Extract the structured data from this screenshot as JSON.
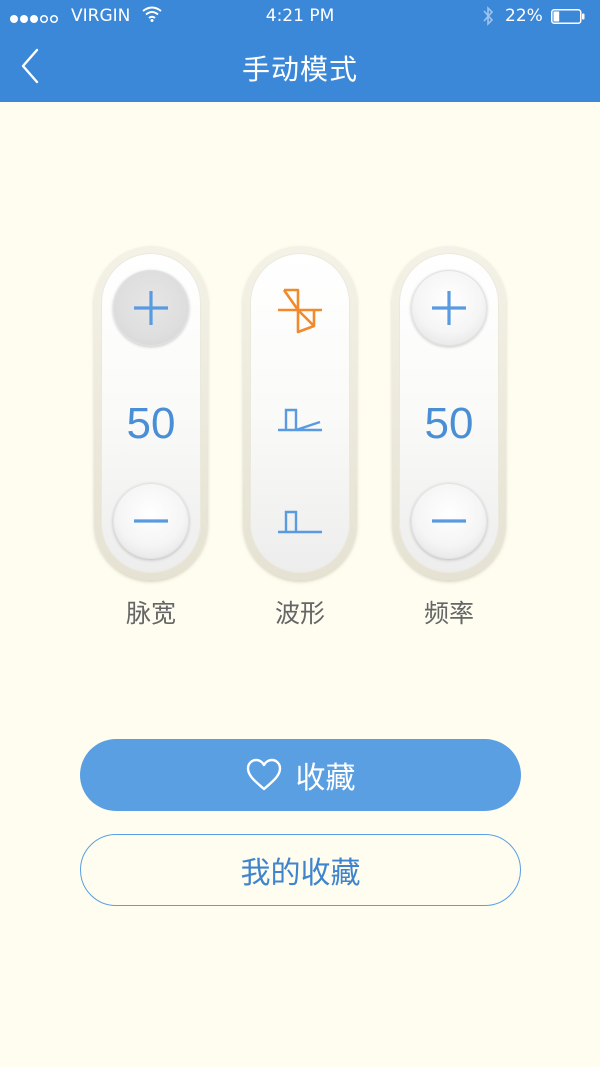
{
  "status_bar": {
    "carrier": "VIRGIN",
    "time": "4:21 PM",
    "battery": "22%",
    "battery_level": 0.22
  },
  "nav": {
    "title": "手动模式",
    "back_icon": "chevron-left-icon"
  },
  "controls": {
    "pulse_width": {
      "label": "脉宽",
      "value": "50"
    },
    "waveform": {
      "label": "波形",
      "options": [
        "waveform-a-icon",
        "waveform-b-icon",
        "waveform-c-icon"
      ],
      "selected_index": 0
    },
    "frequency": {
      "label": "频率",
      "value": "50"
    }
  },
  "actions": {
    "favorite_label": "收藏",
    "favorite_icon": "heart-outline-icon",
    "my_favorites_label": "我的收藏"
  },
  "colors": {
    "header": "#3c88d8",
    "accent": "#4a8fd6",
    "selected": "#f08a2c",
    "background": "#fefdf0"
  }
}
